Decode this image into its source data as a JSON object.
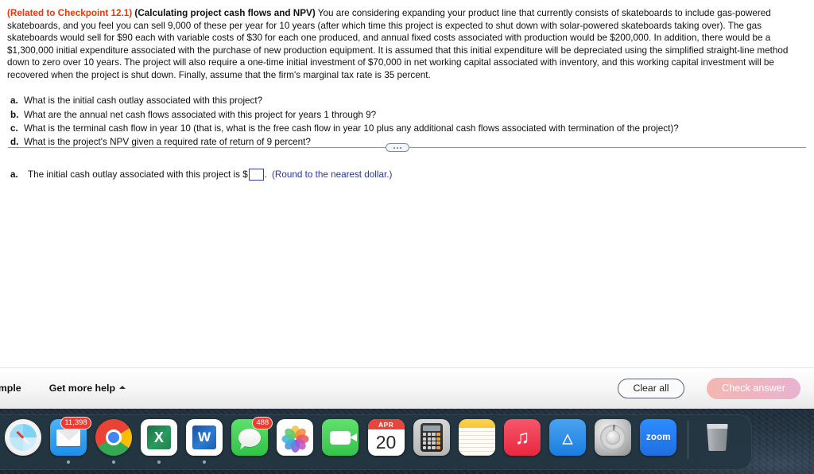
{
  "problem": {
    "checkpoint_tag": "(Related to Checkpoint 12.1)",
    "topic_tag": "(Calculating project cash flows and NPV)",
    "paragraph": " You are considering expanding your product line that currently consists of skateboards to include gas-powered skateboards, and you feel you can sell 9,000 of these per year for 10 years (after which time this project is expected to shut down with solar-powered skateboards taking over).  The gas skateboards would sell for $90 each with variable costs of $30 for each one produced, and annual fixed costs associated with production would be $200,000.  In addition, there would be a $1,300,000 initial expenditure associated with the purchase of new production equipment.  It is assumed that this initial expenditure will be depreciated using the simplified straight-line method down to zero over 10 years.  The project will also require a one-time initial investment of $70,000 in net working capital associated with inventory, and this working capital investment will be recovered when the project is shut down.  Finally, assume that the firm's marginal tax rate is 35 percent.",
    "questions": [
      {
        "label": "a.",
        "text": "What is the initial cash outlay associated with this project?"
      },
      {
        "label": "b.",
        "text": "What are the annual net cash flows associated with this project for years 1 through 9?"
      },
      {
        "label": "c.",
        "text": "What is the terminal cash flow in year 10 (that is, what is the free cash flow in year 10 plus any additional cash flows associated with termination of the project)?"
      },
      {
        "label": "d.",
        "text": "What is the project's NPV given a required rate of return of 9 percent?"
      }
    ]
  },
  "answer_section": {
    "label": "a.",
    "prompt": "The initial cash outlay associated with this project is $",
    "input_value": "",
    "input_placeholder": "",
    "period": ".",
    "rounding_note": "(Round to the nearest dollar.)"
  },
  "toolbar": {
    "example_label": "xample",
    "help_label": "Get more help",
    "clear_label": "Clear all",
    "check_label": "Check answer",
    "accent_clear_border": "#5c6370",
    "accent_check_gradient_start": "#f3b7b0",
    "accent_check_gradient_end": "#e8b3d1"
  },
  "dock": {
    "items": [
      {
        "name": "safari",
        "label": "Safari",
        "badge": null,
        "running": false
      },
      {
        "name": "mail",
        "label": "Mail",
        "badge": "11,398",
        "running": true
      },
      {
        "name": "chrome",
        "label": "Google Chrome",
        "badge": null,
        "running": true
      },
      {
        "name": "excel",
        "label": "Microsoft Excel",
        "badge": null,
        "running": true,
        "glyph": "X"
      },
      {
        "name": "word",
        "label": "Microsoft Word",
        "badge": null,
        "running": true,
        "glyph": "W"
      },
      {
        "name": "messages",
        "label": "Messages",
        "badge": "488",
        "running": true
      },
      {
        "name": "photos",
        "label": "Photos",
        "badge": null,
        "running": false
      },
      {
        "name": "facetime",
        "label": "FaceTime",
        "badge": null,
        "running": false
      },
      {
        "name": "calendar",
        "label": "Calendar",
        "badge": null,
        "running": false,
        "month": "APR",
        "day": "20"
      },
      {
        "name": "calculator",
        "label": "Calculator",
        "badge": null,
        "running": false
      },
      {
        "name": "notes",
        "label": "Notes",
        "badge": null,
        "running": false
      },
      {
        "name": "music",
        "label": "Music",
        "badge": null,
        "running": false
      },
      {
        "name": "appstore",
        "label": "App Store",
        "badge": null,
        "running": false
      },
      {
        "name": "sysprefs",
        "label": "System Preferences",
        "badge": null,
        "running": false
      },
      {
        "name": "zoom",
        "label": "zoom",
        "badge": null,
        "running": false
      }
    ],
    "trash_label": "Trash"
  }
}
